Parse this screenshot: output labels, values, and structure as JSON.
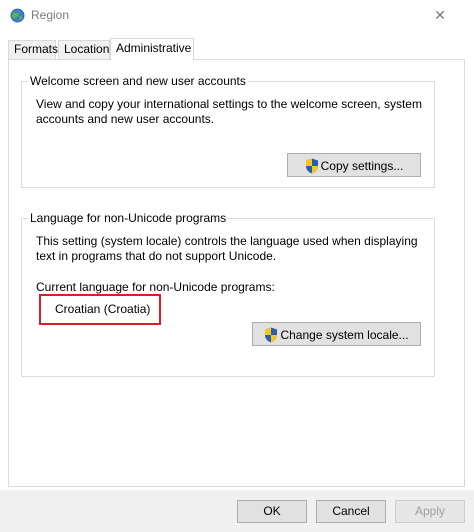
{
  "window": {
    "title": "Region",
    "close_glyph": "✕"
  },
  "tabs": [
    {
      "label": "Formats",
      "active": false
    },
    {
      "label": "Location",
      "active": false
    },
    {
      "label": "Administrative",
      "active": true
    }
  ],
  "welcome_group": {
    "legend": "Welcome screen and new user accounts",
    "description_line1": "View and copy your international settings to the welcome screen, system",
    "description_line2": "accounts and new user accounts.",
    "copy_button_label": "Copy settings..."
  },
  "unicode_group": {
    "legend": "Language for non-Unicode programs",
    "description_line1": "This setting (system locale) controls the language used when displaying",
    "description_line2": "text in programs that do not support Unicode.",
    "current_label": "Current language for non-Unicode programs:",
    "current_value": "Croatian (Croatia)",
    "change_button_label": "Change system locale..."
  },
  "footer": {
    "ok_label": "OK",
    "cancel_label": "Cancel",
    "apply_label": "Apply",
    "apply_enabled": false
  },
  "icons": {
    "title_icon": "globe-icon",
    "button_icon": "uac-shield-icon"
  },
  "colors": {
    "highlight_box": "#d61f26",
    "shield_blue": "#2a5ea8",
    "shield_yellow": "#f3c623"
  }
}
